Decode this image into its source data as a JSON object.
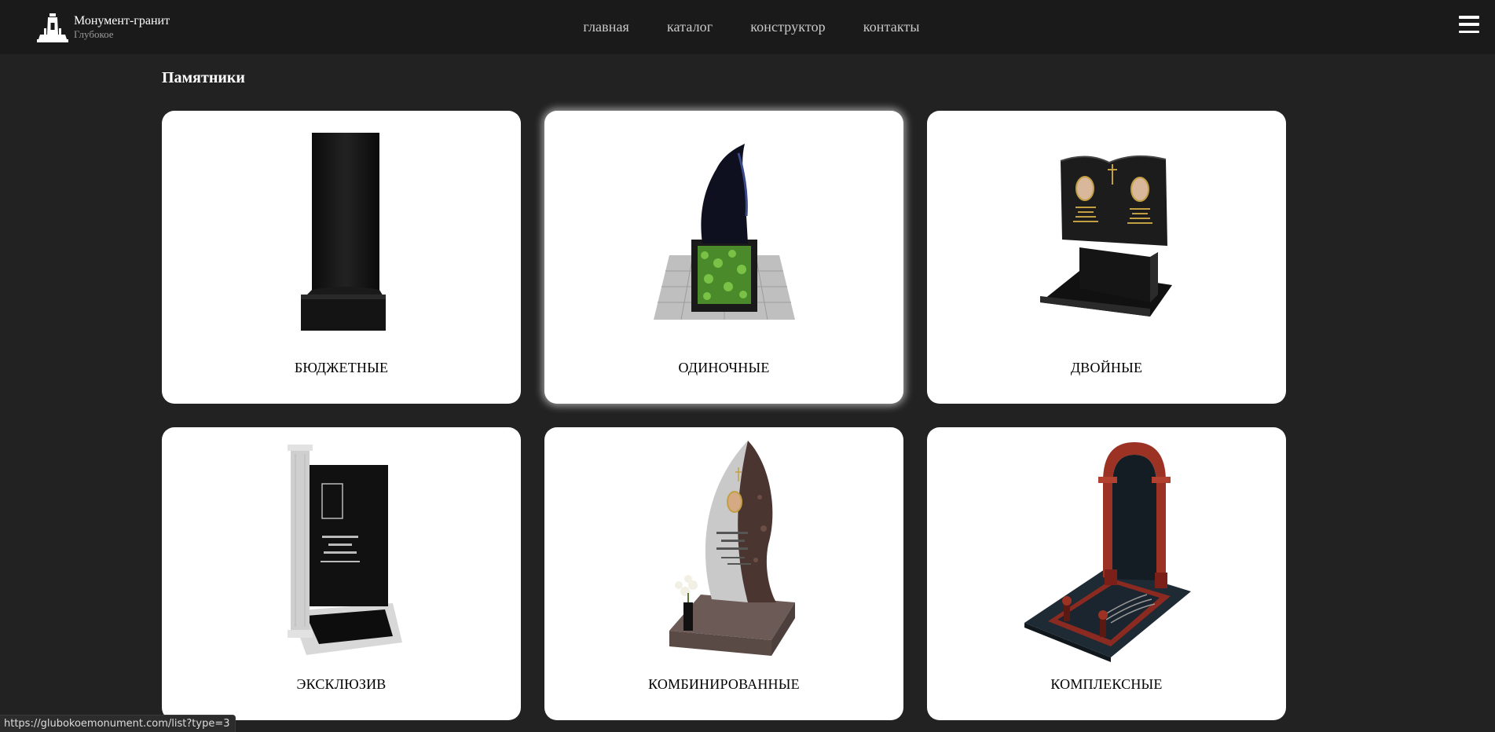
{
  "header": {
    "brand_name": "Монумент-гранит",
    "brand_city": "Глубокое",
    "nav": [
      "главная",
      "каталог",
      "конструктор",
      "контакты"
    ]
  },
  "section": {
    "title": "Памятники"
  },
  "cards": [
    {
      "label": "БЮДЖЕТНЫЕ",
      "icon": "budget-monument-image"
    },
    {
      "label": "ОДИНОЧНЫЕ",
      "icon": "single-monument-image"
    },
    {
      "label": "ДВОЙНЫЕ",
      "icon": "double-monument-image"
    },
    {
      "label": "ЭКСКЛЮЗИВ",
      "icon": "exclusive-monument-image"
    },
    {
      "label": "КОМБИНИРОВАННЫЕ",
      "icon": "combined-monument-image"
    },
    {
      "label": "КОМПЛЕКСНЫЕ",
      "icon": "complex-monument-image"
    }
  ],
  "status_bar": {
    "url": "https://glubokoemonument.com/list?type=3"
  },
  "colors": {
    "page_bg": "#222222",
    "header_bg": "#1a1a1a",
    "card_bg": "#ffffff"
  }
}
